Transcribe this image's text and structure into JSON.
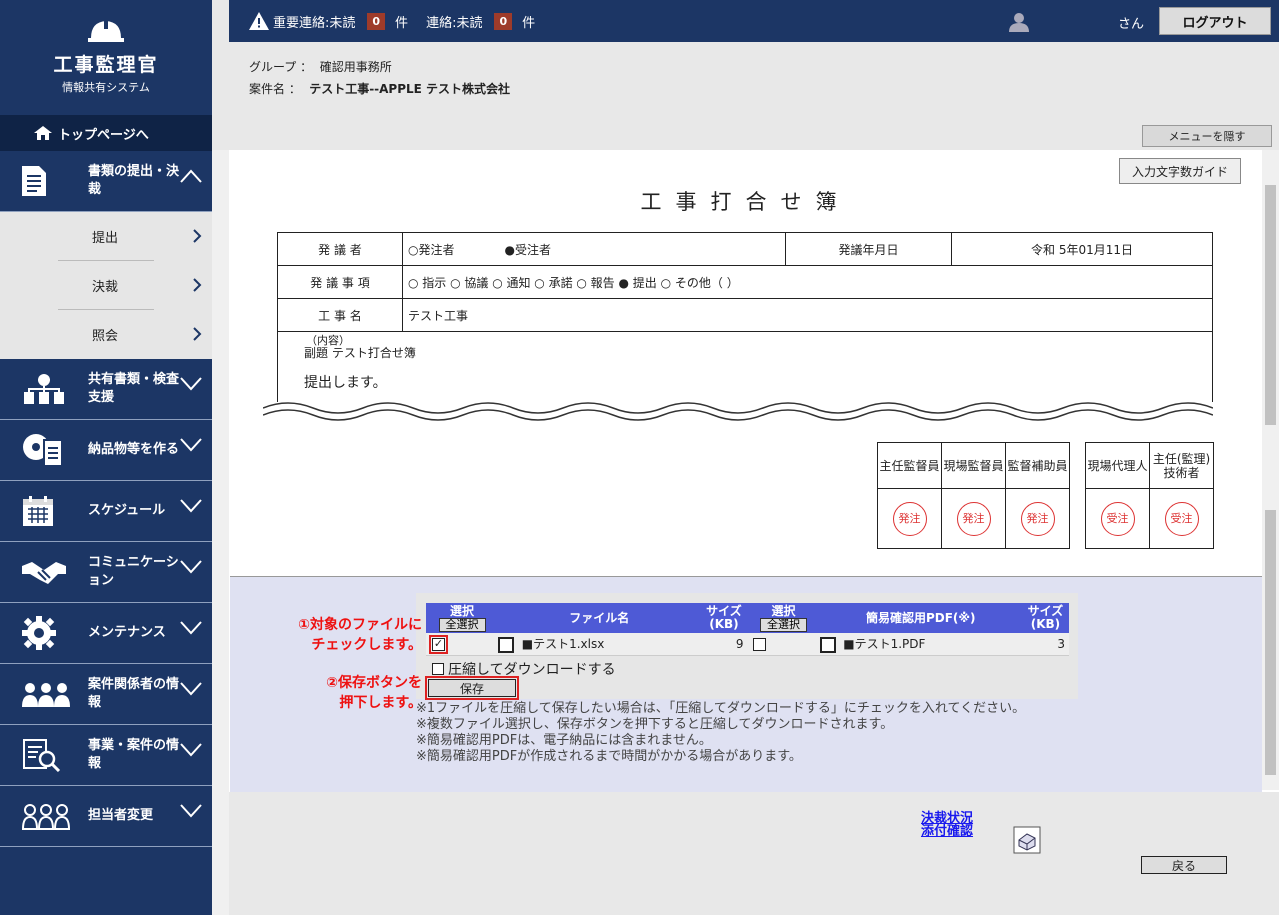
{
  "app": {
    "name": "工事監理官",
    "subtitle": "情報共有システム"
  },
  "nav": {
    "top_link": "トップページへ",
    "sections": [
      {
        "label": "書類の提出・決裁",
        "icon": "document-icon",
        "expanded": true,
        "items": [
          "提出",
          "決裁",
          "照会"
        ]
      },
      {
        "label": "共有書類・検査支援",
        "icon": "shared-docs-icon"
      },
      {
        "label": "納品物等を作る",
        "icon": "disc-document-icon"
      },
      {
        "label": "スケジュール",
        "icon": "calendar-icon"
      },
      {
        "label": "コミュニケーション",
        "icon": "handshake-icon"
      },
      {
        "label": "メンテナンス",
        "icon": "gear-icon"
      },
      {
        "label": "案件関係者の情報",
        "icon": "people-icon"
      },
      {
        "label": "事業・案件の情報",
        "icon": "search-document-icon"
      },
      {
        "label": "担当者変更",
        "icon": "people-change-icon"
      }
    ]
  },
  "header": {
    "important_label": "重要連絡:未読",
    "important_count": "0",
    "unit1": "件",
    "contact_label": "連絡:未読",
    "contact_count": "0",
    "unit2": "件",
    "user_suffix": "さん",
    "logout": "ログアウト"
  },
  "info": {
    "group_label": "グループ ：",
    "group_value": "確認用事務所",
    "case_label": "案件名 ：",
    "case_value": "テスト工事--APPLE テスト株式会社",
    "menu_hide": "メニューを隠す"
  },
  "doc": {
    "guide_button": "入力文字数ガイド",
    "title": "工事打合せ簿",
    "row1": {
      "label": "発 議 者",
      "opt1": "○発注者",
      "opt2": "●受注者",
      "date_label": "発議年月日",
      "date_value": "令和 5年01月11日"
    },
    "row2": {
      "label": "発 議 事 項",
      "options": "○ 指示 ○ 協議 ○ 通知 ○ 承諾 ○ 報告 ● 提出 ○ その他（ ）"
    },
    "row3": {
      "label": "工 事 名",
      "value": "テスト工事"
    },
    "content_label": "（内容）",
    "subject": "副題 テスト打合せ簿",
    "body": "提出します。",
    "stamps_orderer": [
      {
        "title": "主任監督員",
        "seal": "発注"
      },
      {
        "title": "現場監督員",
        "seal": "発注"
      },
      {
        "title": "監督補助員",
        "seal": "発注"
      }
    ],
    "stamps_contractor": [
      {
        "title": "現場代理人",
        "seal": "受注"
      },
      {
        "title": "主任(監理)技術者",
        "seal": "受注"
      }
    ]
  },
  "files": {
    "headers": {
      "select": "選択",
      "select_all": "全選択",
      "file_name": "ファイル名",
      "size": "サイズ(KB)",
      "pdf_name": "簡易確認用PDF(※)"
    },
    "rows": [
      {
        "file": "■テスト1.xlsx",
        "size": "9",
        "pdf": "■テスト1.PDF",
        "pdf_size": "3",
        "checked": true
      }
    ],
    "compress_label": "圧縮してダウンロードする",
    "save_button": "保存",
    "notes": [
      "※1ファイルを圧縮して保存したい場合は、「圧縮してダウンロードする」にチェックを入れてください。",
      "※複数ファイル選択し、保存ボタンを押下すると圧縮してダウンロードされます。",
      "※簡易確認用PDFは、電子納品には含まれません。",
      "※簡易確認用PDFが作成されるまで時間がかかる場合があります。"
    ],
    "callout1_line1": "①対象のファイルに",
    "callout1_line2": "チェックします。",
    "callout2_line1": "②保存ボタンを",
    "callout2_line2": "押下します。"
  },
  "footer": {
    "link_line1": "決裁状況",
    "link_line2": "添付確認",
    "back": "戻る"
  }
}
